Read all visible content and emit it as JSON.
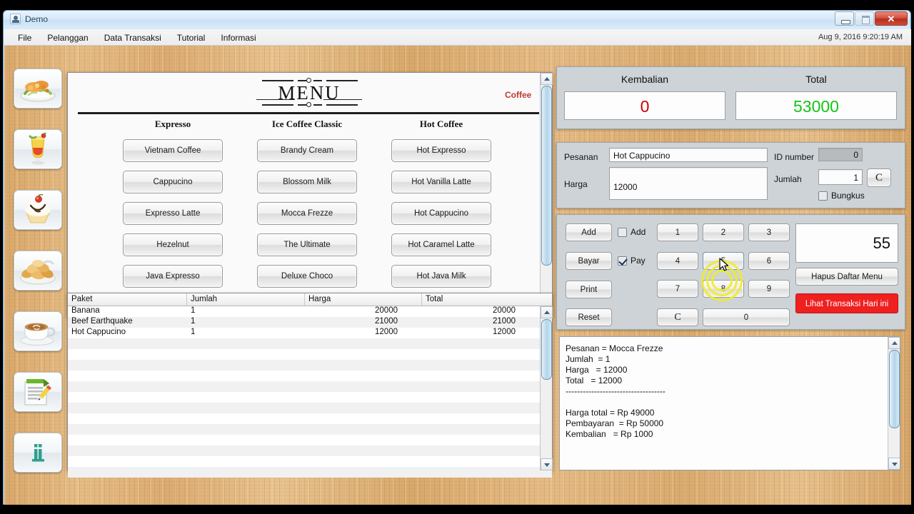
{
  "window": {
    "title": "Demo",
    "app_icon": "user-icon",
    "buttons": {
      "minimize": "minimize-icon",
      "maximize": "maximize-icon",
      "close": "✕"
    }
  },
  "menubar": {
    "items": [
      "File",
      "Pelanggan",
      "Data Transaksi",
      "Tutorial",
      "Informasi"
    ],
    "clock": "Aug 9, 2016 9:20:19 AM"
  },
  "sidebar": {
    "items": [
      {
        "name": "salad-plate-icon"
      },
      {
        "name": "cocktail-drink-icon"
      },
      {
        "name": "ice-cream-sundae-icon"
      },
      {
        "name": "fried-snacks-icon"
      },
      {
        "name": "coffee-cup-icon"
      },
      {
        "name": "order-note-icon"
      },
      {
        "name": "info-icon"
      }
    ]
  },
  "menu_card": {
    "logo": "MENU",
    "tag": "Coffee",
    "columns": [
      {
        "title": "Expresso",
        "items": [
          "Vietnam Coffee",
          "Cappucino",
          "Expresso Latte",
          "Hezelnut",
          "Java Expresso"
        ]
      },
      {
        "title": "Ice Coffee Classic",
        "items": [
          "Brandy Cream",
          "Blossom Milk",
          "Mocca Frezze",
          "The Ultimate",
          "Deluxe Choco"
        ]
      },
      {
        "title": "Hot Coffee",
        "items": [
          "Hot Expresso",
          "Hot Vanilla Latte",
          "Hot Cappucino",
          "Hot Caramel Latte",
          "Hot Java Milk"
        ]
      }
    ]
  },
  "table": {
    "headers": [
      "Paket",
      "Jumlah",
      "Harga",
      "Total"
    ],
    "rows": [
      [
        "Banana",
        "1",
        "20000",
        "20000"
      ],
      [
        "Beef Earthquake",
        "1",
        "21000",
        "21000"
      ],
      [
        "Hot Cappucino",
        "1",
        "12000",
        "12000"
      ]
    ]
  },
  "totals": {
    "kembalian_label": "Kembalian",
    "kembalian_value": "0",
    "kembalian_color": "#cc0000",
    "total_label": "Total",
    "total_value": "53000",
    "total_color": "#14c414"
  },
  "order_form": {
    "pesanan_label": "Pesanan",
    "pesanan_value": "Hot Cappucino",
    "harga_label": "Harga",
    "harga_value": "12000",
    "id_label": "ID number",
    "id_value": "0",
    "jumlah_label": "Jumlah",
    "jumlah_value": "1",
    "clear_button": "C",
    "bungkus_label": "Bungkus",
    "bungkus_checked": false
  },
  "controls": {
    "actions": [
      "Add",
      "Bayar",
      "Print",
      "Reset"
    ],
    "checkboxes": [
      {
        "label": "Add",
        "checked": false
      },
      {
        "label": "Pay",
        "checked": true
      }
    ],
    "keypad": [
      "1",
      "2",
      "3",
      "4",
      "5",
      "6",
      "7",
      "8",
      "9",
      "C",
      "0"
    ],
    "display_value": "55",
    "clear_menu_button": "Hapus Daftar Menu",
    "view_transactions_button": "Lihat Transaksi Hari ini",
    "view_transactions_color": "#ef2020",
    "highlighted_key": "5"
  },
  "receipt": {
    "text": "Pesanan = Mocca Frezze\nJumlah  = 1\nHarga   = 12000\nTotal   = 12000\n-----------------------------------\n\nHarga total = Rp 49000\nPembayaran  = Rp 50000\nKembalian   = Rp 1000"
  }
}
